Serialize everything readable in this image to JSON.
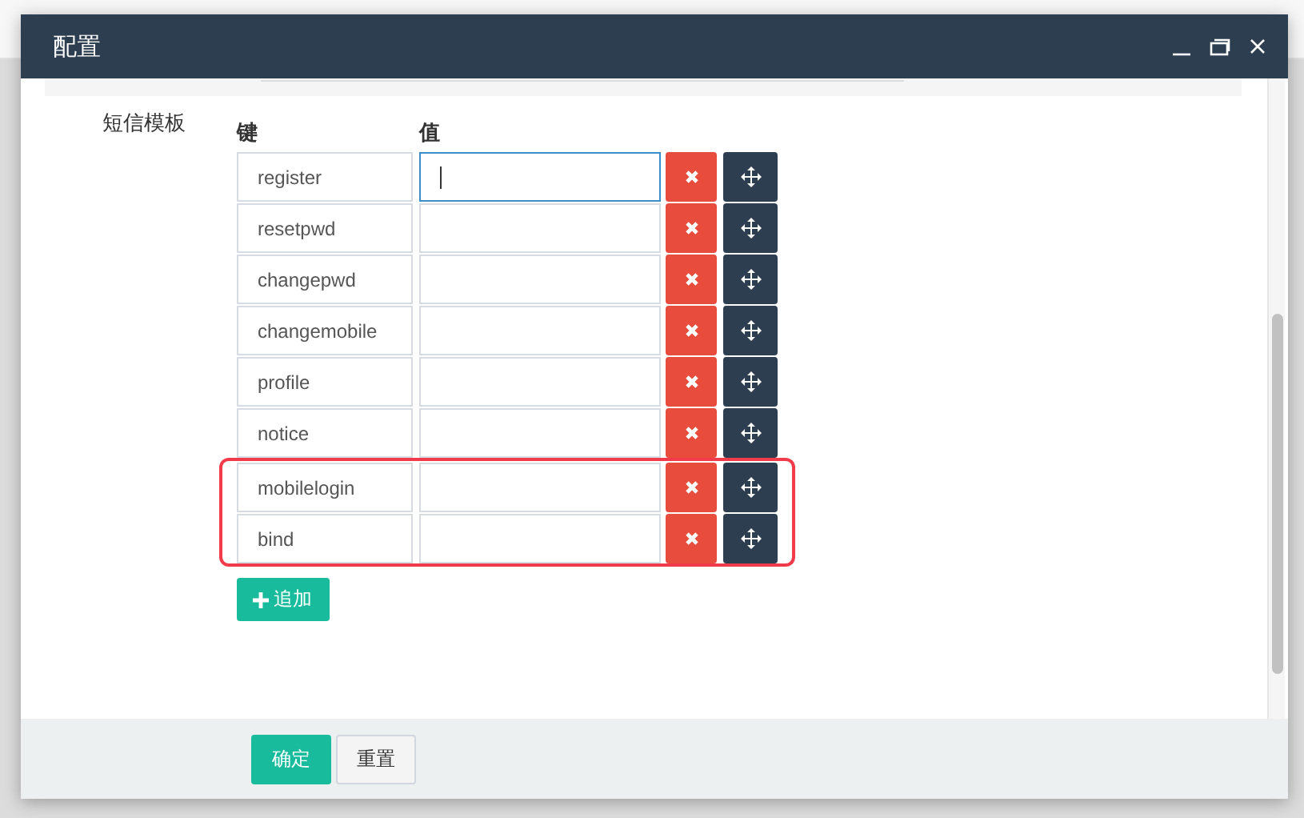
{
  "window": {
    "title": "配置"
  },
  "field": {
    "label": "短信模板",
    "columns": [
      "键",
      "值"
    ],
    "rows": [
      {
        "key": "register",
        "focused": true,
        "highlighted": false
      },
      {
        "key": "resetpwd",
        "focused": false,
        "highlighted": false
      },
      {
        "key": "changepwd",
        "focused": false,
        "highlighted": false
      },
      {
        "key": "changemobile",
        "focused": false,
        "highlighted": false
      },
      {
        "key": "profile",
        "focused": false,
        "highlighted": false
      },
      {
        "key": "notice",
        "focused": false,
        "highlighted": false
      },
      {
        "key": "mobilelogin",
        "focused": false,
        "highlighted": true
      },
      {
        "key": "bind",
        "focused": false,
        "highlighted": true
      }
    ],
    "add_button": "追加"
  },
  "footer": {
    "buttons": [
      {
        "label": "确定",
        "kind": "primary"
      },
      {
        "label": "重置",
        "kind": "default"
      }
    ]
  }
}
